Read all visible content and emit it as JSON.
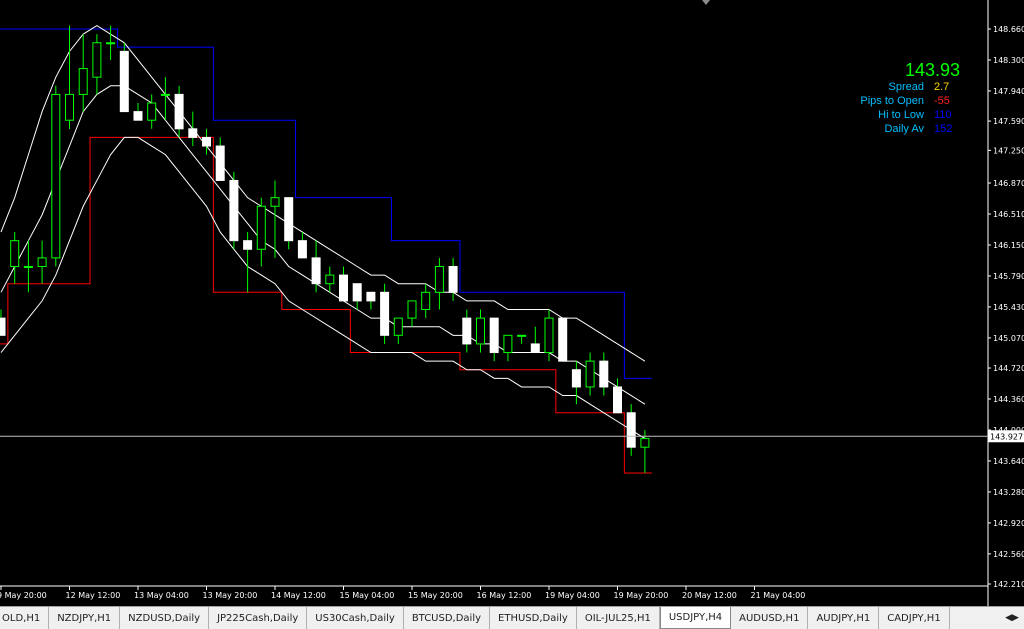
{
  "symbol_tab_active": "USDJPY,H4",
  "tabs": [
    "OLD,H1",
    "NZDJPY,H1",
    "NZDUSD,Daily",
    "JP225Cash,Daily",
    "US30Cash,Daily",
    "BTCUSD,Daily",
    "ETHUSD,Daily",
    "OIL-JUL25,H1",
    "USDJPY,H4",
    "AUDUSD,H1",
    "AUDJPY,H1",
    "CADJPY,H1"
  ],
  "tab_scroll_icon": "scroll-arrows-icon",
  "info": {
    "price": "143.93",
    "price_color": "#00ff00",
    "rows": [
      {
        "label": "Spread",
        "value": "2.7",
        "color": "#ffd700"
      },
      {
        "label": "Pips to Open",
        "value": "-55",
        "color": "#ff2020"
      },
      {
        "label": "Hi to Low",
        "value": "110",
        "color": "#0000ff"
      },
      {
        "label": "Daily Av",
        "value": "152",
        "color": "#0000ff"
      }
    ]
  },
  "chart_data": {
    "type": "candlestick",
    "y_ticks": [
      "148.660",
      "148.300",
      "147.940",
      "147.590",
      "147.250",
      "146.870",
      "146.510",
      "146.150",
      "145.790",
      "145.430",
      "145.070",
      "144.720",
      "144.360",
      "144.000",
      "143.640",
      "143.280",
      "142.920",
      "142.560",
      "142.210"
    ],
    "ylim": [
      142.21,
      148.66
    ],
    "current_price_label": "143.927",
    "current_price": 143.927,
    "x_ticks": [
      "9 May 20:00",
      "12 May 12:00",
      "13 May 04:00",
      "13 May 20:00",
      "14 May 12:00",
      "15 May 04:00",
      "15 May 20:00",
      "16 May 12:00",
      "19 May 04:00",
      "19 May 20:00",
      "20 May 12:00",
      "21 May 04:00"
    ],
    "x_tick_bar_index": [
      0,
      5,
      10,
      15,
      20,
      25,
      30,
      35,
      40,
      45,
      50,
      55
    ],
    "colors": {
      "bull_fill": "#000000",
      "bear_fill": "#ffffff",
      "bull_outline": "#00ff00",
      "bear_outline": "#ffffff",
      "wick": "#00ff00",
      "upper_channel": "#0000ff",
      "lower_channel": "#ff0000",
      "bands": "#ffffff",
      "grid": "none"
    },
    "grid": false,
    "candles": [
      {
        "o": 145.3,
        "h": 145.4,
        "l": 145.1,
        "c": 145.1
      },
      {
        "o": 145.9,
        "h": 146.3,
        "l": 145.7,
        "c": 146.2
      },
      {
        "o": 145.9,
        "h": 146.2,
        "l": 145.6,
        "c": 145.9
      },
      {
        "o": 145.9,
        "h": 146.2,
        "l": 145.7,
        "c": 146.0
      },
      {
        "o": 146.0,
        "h": 148.0,
        "l": 145.9,
        "c": 147.9
      },
      {
        "o": 147.6,
        "h": 148.7,
        "l": 147.5,
        "c": 147.9
      },
      {
        "o": 147.9,
        "h": 148.6,
        "l": 147.7,
        "c": 148.2
      },
      {
        "o": 148.1,
        "h": 148.6,
        "l": 147.9,
        "c": 148.5
      },
      {
        "o": 148.5,
        "h": 148.7,
        "l": 148.3,
        "c": 148.5
      },
      {
        "o": 148.4,
        "h": 148.5,
        "l": 147.7,
        "c": 147.7
      },
      {
        "o": 147.7,
        "h": 147.8,
        "l": 147.6,
        "c": 147.6
      },
      {
        "o": 147.6,
        "h": 147.9,
        "l": 147.5,
        "c": 147.8
      },
      {
        "o": 147.9,
        "h": 148.1,
        "l": 147.6,
        "c": 147.9
      },
      {
        "o": 147.9,
        "h": 148.0,
        "l": 147.4,
        "c": 147.5
      },
      {
        "o": 147.5,
        "h": 147.7,
        "l": 147.3,
        "c": 147.4
      },
      {
        "o": 147.4,
        "h": 147.5,
        "l": 147.2,
        "c": 147.3
      },
      {
        "o": 147.3,
        "h": 147.4,
        "l": 146.9,
        "c": 146.9
      },
      {
        "o": 146.9,
        "h": 147.0,
        "l": 146.1,
        "c": 146.2
      },
      {
        "o": 146.2,
        "h": 146.3,
        "l": 145.6,
        "c": 146.1
      },
      {
        "o": 146.1,
        "h": 146.7,
        "l": 145.9,
        "c": 146.6
      },
      {
        "o": 146.6,
        "h": 146.9,
        "l": 146.0,
        "c": 146.7
      },
      {
        "o": 146.7,
        "h": 146.7,
        "l": 146.1,
        "c": 146.2
      },
      {
        "o": 146.2,
        "h": 146.3,
        "l": 146.0,
        "c": 146.0
      },
      {
        "o": 146.0,
        "h": 146.2,
        "l": 145.6,
        "c": 145.7
      },
      {
        "o": 145.7,
        "h": 145.9,
        "l": 145.6,
        "c": 145.8
      },
      {
        "o": 145.8,
        "h": 145.9,
        "l": 145.5,
        "c": 145.5
      },
      {
        "o": 145.7,
        "h": 145.7,
        "l": 145.4,
        "c": 145.5
      },
      {
        "o": 145.6,
        "h": 145.6,
        "l": 145.4,
        "c": 145.5
      },
      {
        "o": 145.6,
        "h": 145.7,
        "l": 145.0,
        "c": 145.1
      },
      {
        "o": 145.1,
        "h": 145.3,
        "l": 145.0,
        "c": 145.3
      },
      {
        "o": 145.3,
        "h": 145.5,
        "l": 145.2,
        "c": 145.5
      },
      {
        "o": 145.4,
        "h": 145.7,
        "l": 145.3,
        "c": 145.6
      },
      {
        "o": 145.6,
        "h": 146.0,
        "l": 145.4,
        "c": 145.9
      },
      {
        "o": 145.9,
        "h": 146.0,
        "l": 145.5,
        "c": 145.6
      },
      {
        "o": 145.3,
        "h": 145.4,
        "l": 144.9,
        "c": 145.0
      },
      {
        "o": 145.0,
        "h": 145.4,
        "l": 144.9,
        "c": 145.3
      },
      {
        "o": 145.3,
        "h": 145.3,
        "l": 144.8,
        "c": 144.9
      },
      {
        "o": 144.9,
        "h": 145.1,
        "l": 144.8,
        "c": 145.1
      },
      {
        "o": 145.1,
        "h": 145.1,
        "l": 145.0,
        "c": 145.1
      },
      {
        "o": 145.0,
        "h": 145.2,
        "l": 144.9,
        "c": 144.9
      },
      {
        "o": 144.9,
        "h": 145.4,
        "l": 144.8,
        "c": 145.3
      },
      {
        "o": 145.3,
        "h": 145.3,
        "l": 144.8,
        "c": 144.8
      },
      {
        "o": 144.7,
        "h": 144.8,
        "l": 144.3,
        "c": 144.5
      },
      {
        "o": 144.5,
        "h": 144.9,
        "l": 144.4,
        "c": 144.8
      },
      {
        "o": 144.8,
        "h": 144.9,
        "l": 144.4,
        "c": 144.5
      },
      {
        "o": 144.5,
        "h": 144.6,
        "l": 144.2,
        "c": 144.2
      },
      {
        "o": 144.2,
        "h": 144.3,
        "l": 143.7,
        "c": 143.8
      },
      {
        "o": 143.8,
        "h": 144.0,
        "l": 143.5,
        "c": 143.9
      }
    ],
    "upper_channel": [
      148.66,
      148.66,
      148.66,
      148.66,
      148.66,
      148.66,
      148.66,
      148.66,
      148.66,
      148.45,
      148.45,
      148.45,
      148.45,
      148.45,
      148.45,
      148.45,
      147.6,
      147.6,
      147.6,
      147.6,
      147.6,
      147.6,
      146.7,
      146.7,
      146.7,
      146.7,
      146.7,
      146.7,
      146.7,
      146.2,
      146.2,
      146.2,
      146.2,
      146.2,
      145.6,
      145.6,
      145.6,
      145.6,
      145.6,
      145.6,
      145.6,
      145.6,
      145.6,
      145.6,
      145.6,
      145.6,
      144.6,
      144.6
    ],
    "lower_channel": [
      145.0,
      145.7,
      145.7,
      145.7,
      145.7,
      145.7,
      145.7,
      147.4,
      147.4,
      147.4,
      147.4,
      147.4,
      147.4,
      147.4,
      147.4,
      147.4,
      145.6,
      145.6,
      145.6,
      145.6,
      145.6,
      145.4,
      145.4,
      145.4,
      145.4,
      145.4,
      144.9,
      144.9,
      144.9,
      144.9,
      144.9,
      144.9,
      144.9,
      144.9,
      144.7,
      144.7,
      144.7,
      144.7,
      144.7,
      144.7,
      144.7,
      144.2,
      144.2,
      144.2,
      144.2,
      144.2,
      143.5,
      143.5
    ],
    "upper_band": [
      146.3,
      146.7,
      147.2,
      147.7,
      148.1,
      148.4,
      148.6,
      148.7,
      148.6,
      148.5,
      148.3,
      148.1,
      147.9,
      147.7,
      147.5,
      147.3,
      147.1,
      146.9,
      146.7,
      146.6,
      146.5,
      146.4,
      146.3,
      146.2,
      146.1,
      146.0,
      145.9,
      145.8,
      145.8,
      145.7,
      145.7,
      145.7,
      145.6,
      145.6,
      145.5,
      145.5,
      145.5,
      145.4,
      145.4,
      145.4,
      145.4,
      145.3,
      145.3,
      145.2,
      145.1,
      145.0,
      144.9,
      144.8
    ],
    "middle_band": [
      145.6,
      145.9,
      146.2,
      146.5,
      146.9,
      147.3,
      147.7,
      147.9,
      148.0,
      148.0,
      147.9,
      147.8,
      147.6,
      147.4,
      147.2,
      147.0,
      146.8,
      146.6,
      146.4,
      146.2,
      146.1,
      145.9,
      145.8,
      145.7,
      145.6,
      145.5,
      145.4,
      145.3,
      145.3,
      145.2,
      145.2,
      145.2,
      145.2,
      145.1,
      145.1,
      145.0,
      145.0,
      144.9,
      144.9,
      144.9,
      144.9,
      144.8,
      144.8,
      144.7,
      144.6,
      144.5,
      144.4,
      144.3
    ],
    "lower_band": [
      144.9,
      145.1,
      145.3,
      145.5,
      145.8,
      146.2,
      146.6,
      146.9,
      147.2,
      147.4,
      147.4,
      147.3,
      147.2,
      147.0,
      146.8,
      146.6,
      146.3,
      146.1,
      145.9,
      145.8,
      145.7,
      145.5,
      145.4,
      145.3,
      145.2,
      145.1,
      145.0,
      144.9,
      144.9,
      144.9,
      144.9,
      144.8,
      144.8,
      144.8,
      144.7,
      144.7,
      144.6,
      144.6,
      144.5,
      144.5,
      144.5,
      144.4,
      144.4,
      144.3,
      144.2,
      144.1,
      144.0,
      143.9
    ]
  }
}
